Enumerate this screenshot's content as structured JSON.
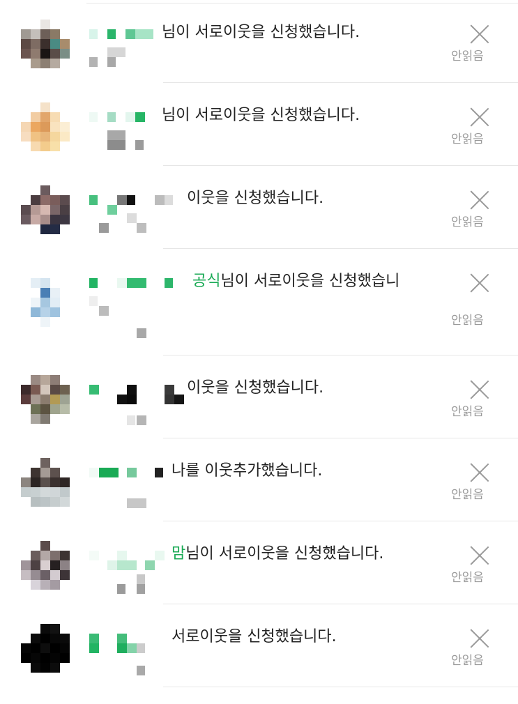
{
  "colors": {
    "highlight": "#1aaa55",
    "text": "#222222",
    "muted": "#9a9a9a",
    "divider": "#e6e6e6"
  },
  "notifications": [
    {
      "prefix": "",
      "message": "님이 서로이웃을 신청했습니다.",
      "unread_label": "안읽음",
      "close_icon": "close-icon"
    },
    {
      "prefix": "",
      "message": "님이 서로이웃을 신청했습니다.",
      "unread_label": "안읽음",
      "close_icon": "close-icon"
    },
    {
      "prefix": "",
      "message": "이웃을 신청했습니다.",
      "unread_label": "안읽음",
      "close_icon": "close-icon"
    },
    {
      "prefix": "공식",
      "message": "님이 서로이웃을 신청했습니",
      "unread_label": "안읽음",
      "close_icon": "close-icon"
    },
    {
      "prefix": "",
      "message": "이웃을 신청했습니다.",
      "unread_label": "안읽음",
      "close_icon": "close-icon"
    },
    {
      "prefix": "",
      "message": "나를 이웃추가했습니다.",
      "unread_label": "안읽음",
      "close_icon": "close-icon"
    },
    {
      "prefix": "맘",
      "message": "님이 서로이웃을 신청했습니다.",
      "unread_label": "안읽음",
      "close_icon": "close-icon"
    },
    {
      "prefix": "",
      "message": "서로이웃을 신청했습니다.",
      "unread_label": "안읽음",
      "close_icon": "close-icon"
    }
  ]
}
